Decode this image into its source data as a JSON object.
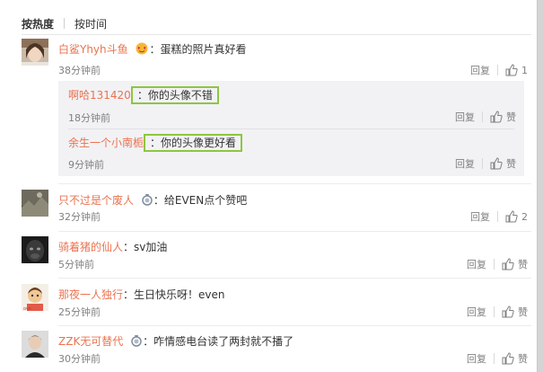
{
  "sort": {
    "hot_label": "按热度",
    "time_label": "按时间"
  },
  "comments": [
    {
      "user": "白鲨Yhyh斗鱼",
      "text": "蛋糕的照片真好看",
      "time": "38分钟前",
      "reply": "回复",
      "likes": "1"
    },
    {
      "user": "只不过是个废人",
      "text": "给EVEN点个赞吧",
      "time": "32分钟前",
      "reply": "回复",
      "likes": "2"
    },
    {
      "user": "骑着猪的仙人",
      "text": "sv加油",
      "time": "5分钟前",
      "reply": "回复",
      "likes": "赞"
    },
    {
      "user": "那夜一人独行",
      "text": "生日快乐呀！even",
      "time": "25分钟前",
      "reply": "回复",
      "likes": "赞"
    },
    {
      "user": "ZZK无可替代",
      "text": "咋情感电台读了两封就不播了",
      "time": "30分钟前",
      "reply": "回复",
      "likes": "赞"
    }
  ],
  "subreplies": [
    {
      "user": "啊哈131420",
      "text": "你的头像不错",
      "time": "18分钟前",
      "reply": "回复",
      "likes": "赞"
    },
    {
      "user": "余生一个小南栀",
      "text": "你的头像更好看",
      "time": "9分钟前",
      "reply": "回复",
      "likes": "赞"
    }
  ],
  "colon": "：",
  "colors": {
    "username": "#eb7350",
    "highlight_box": "#8dc63f",
    "subreply_bg": "#f2f2f5"
  },
  "icons": {
    "like": "thumbs-up-icon",
    "vip": "heart-eyes-badge-icon",
    "medal": "medal-badge-icon"
  }
}
